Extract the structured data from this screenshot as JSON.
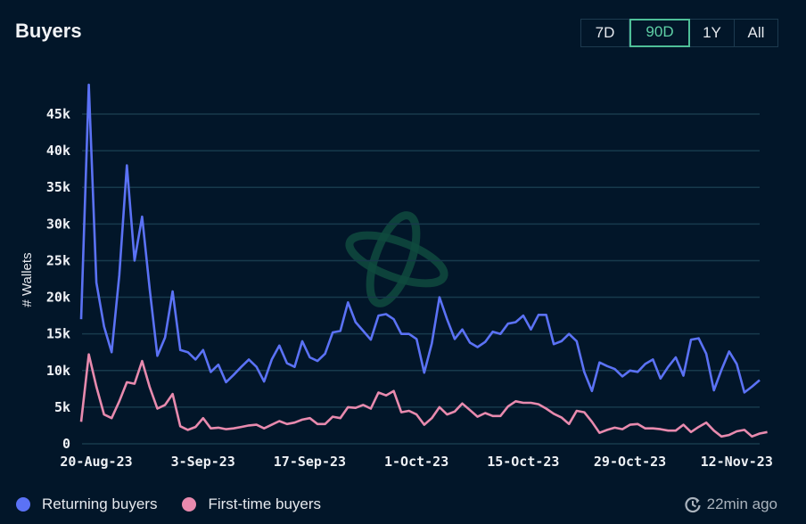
{
  "header": {
    "title": "Buyers",
    "ranges": [
      {
        "label": "7D",
        "active": false
      },
      {
        "label": "90D",
        "active": true
      },
      {
        "label": "1Y",
        "active": false
      },
      {
        "label": "All",
        "active": false
      }
    ]
  },
  "footer": {
    "updated_icon": "refresh-clock-icon",
    "updated_text": "22min ago"
  },
  "colors": {
    "background": "#021629",
    "returning": "#5b72f5",
    "first_time": "#e88aae",
    "grid": "#173a4c",
    "active_range": "#4fbf98",
    "watermark": "#0f4a3e"
  },
  "chart_data": {
    "type": "line",
    "title": "Buyers",
    "xlabel": "",
    "ylabel": "# Wallets",
    "ylim": [
      0,
      45000
    ],
    "yticks": [
      0,
      5000,
      10000,
      15000,
      20000,
      25000,
      30000,
      35000,
      40000,
      45000
    ],
    "ytick_labels": [
      "0",
      "5k",
      "10k",
      "15k",
      "20k",
      "25k",
      "30k",
      "35k",
      "40k",
      "45k"
    ],
    "xtick_labels": [
      "20-Aug-23",
      "3-Sep-23",
      "17-Sep-23",
      "1-Oct-23",
      "15-Oct-23",
      "29-Oct-23",
      "12-Nov-23"
    ],
    "xtick_day_index": [
      0,
      14,
      28,
      42,
      56,
      70,
      84
    ],
    "x_start": "20-Aug-23",
    "grid": true,
    "legend_position": "bottom-left",
    "series": [
      {
        "name": "Returning buyers",
        "color": "#5b72f5",
        "values": [
          17000,
          49000,
          22000,
          16000,
          12500,
          23000,
          38000,
          25000,
          31000,
          21000,
          12000,
          14500,
          20800,
          12800,
          12500,
          11500,
          12800,
          9800,
          10800,
          8400,
          9400,
          10500,
          11500,
          10500,
          8500,
          11500,
          13400,
          11000,
          10500,
          14000,
          11800,
          11300,
          12300,
          15200,
          15400,
          19300,
          16600,
          15400,
          14200,
          17500,
          17700,
          17000,
          15000,
          15000,
          14300,
          9700,
          13700,
          20000,
          17000,
          14300,
          15600,
          13800,
          13200,
          13900,
          15300,
          15000,
          16400,
          16600,
          17500,
          15600,
          17600,
          17600,
          13600,
          14000,
          15000,
          14000,
          9800,
          7200,
          11100,
          10600,
          10200,
          9200,
          10000,
          9800,
          10900,
          11500,
          8900,
          10500,
          11800,
          9300,
          14200,
          14400,
          12300,
          7300,
          10100,
          12600,
          10900,
          7000,
          7800,
          8700
        ]
      },
      {
        "name": "First-time buyers",
        "color": "#e88aae",
        "values": [
          3000,
          12200,
          7800,
          4000,
          3500,
          5800,
          8400,
          8200,
          11300,
          7700,
          4800,
          5300,
          6800,
          2400,
          1900,
          2300,
          3500,
          2100,
          2200,
          2000,
          2100,
          2300,
          2500,
          2600,
          2100,
          2600,
          3100,
          2700,
          2900,
          3300,
          3500,
          2700,
          2700,
          3700,
          3500,
          5000,
          4900,
          5300,
          4800,
          7000,
          6600,
          7200,
          4300,
          4500,
          4000,
          2600,
          3500,
          5000,
          4000,
          4400,
          5500,
          4600,
          3700,
          4200,
          3800,
          3800,
          5100,
          5800,
          5600,
          5600,
          5400,
          4800,
          4100,
          3600,
          2700,
          4500,
          4300,
          3000,
          1500,
          1900,
          2200,
          2000,
          2600,
          2700,
          2100,
          2100,
          2000,
          1800,
          1800,
          2600,
          1600,
          2300,
          2900,
          1800,
          1000,
          1200,
          1700,
          1900,
          1000,
          1400,
          1600
        ]
      }
    ]
  }
}
